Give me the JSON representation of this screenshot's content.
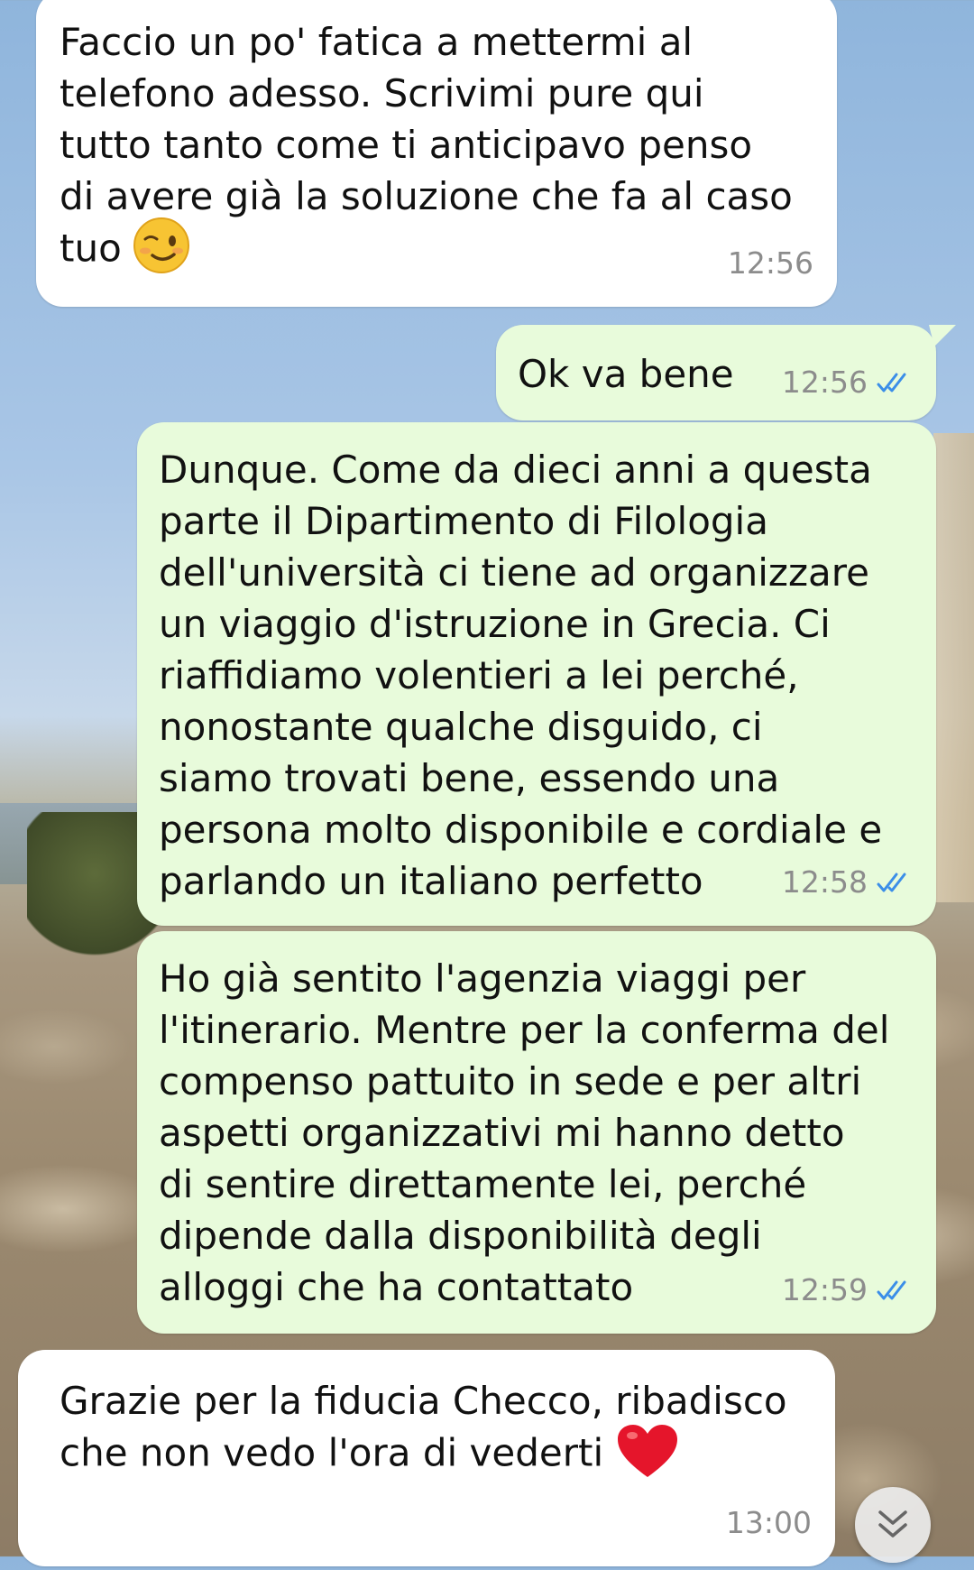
{
  "messages": [
    {
      "direction": "incoming",
      "text": "Faccio un po' fatica a mettermi al\ntelefono adesso. Scrivimi pure qui\ntutto tanto come ti anticipavo penso\ndi avere già la soluzione che fa al caso\ntuo",
      "emoji": "wink-emoji",
      "time": "12:56"
    },
    {
      "direction": "outgoing",
      "text": "Ok va bene",
      "time": "12:56",
      "status": "read"
    },
    {
      "direction": "outgoing",
      "text": "Dunque. Come da dieci anni a questa\nparte il Dipartimento di Filologia\ndell'università ci tiene ad organizzare\nun viaggio d'istruzione in Grecia. Ci\nriaffidiamo volentieri a lei perché,\nnonostante qualche disguido, ci\nsiamo trovati bene, essendo una\npersona molto disponibile e cordiale e\nparlando un italiano perfetto",
      "time": "12:58",
      "status": "read"
    },
    {
      "direction": "outgoing",
      "text": "Ho già sentito l'agenzia viaggi per\nl'itinerario. Mentre per la conferma del\ncompenso pattuito in sede e per altri\naspetti organizzativi mi hanno detto\ndi sentire direttamente lei, perché\ndipende dalla disponibilità degli\nalloggi che ha contattato",
      "time": "12:59",
      "status": "read"
    },
    {
      "direction": "incoming",
      "text": "Grazie per la fiducia Checco, ribadisco\nche non vedo l'ora di vederti",
      "emoji": "red-heart-emoji",
      "time": "13:00"
    }
  ],
  "colors": {
    "incoming": "#ffffff",
    "outgoing": "#e8fbdb",
    "read_check": "#3b8ee8",
    "timestamp": "#8c8c8c"
  },
  "scroll_button_icon": "double-chevron-down-icon"
}
